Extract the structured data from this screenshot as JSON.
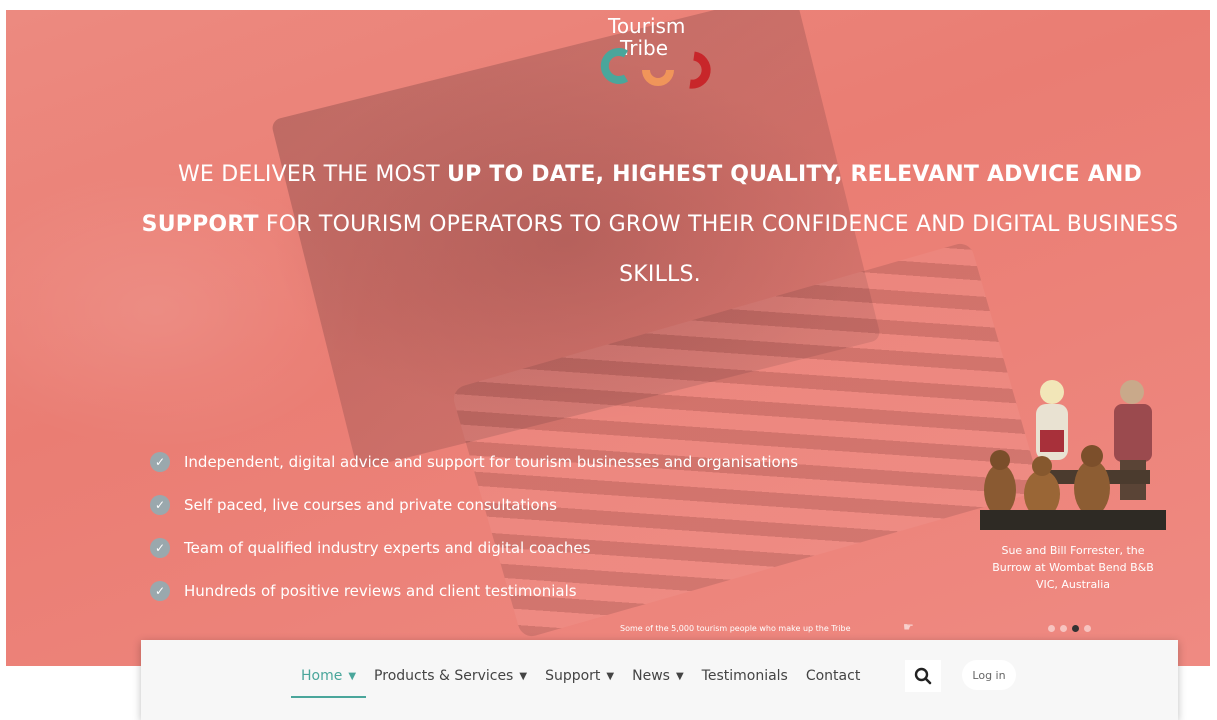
{
  "logo": {
    "line1": "Tourism",
    "line2": "Tribe"
  },
  "headline": {
    "p1": "We deliver the most ",
    "b1": "up to date, highest quality, relevant advice and support",
    "p2": " for tourism operators to grow their confidence and digital business skills."
  },
  "features": [
    "Independent, digital advice and support for tourism businesses and organisations",
    "Self paced, live courses and private consultations",
    "Team of qualified industry experts and digital coaches",
    "Hundreds of positive reviews and client testimonials"
  ],
  "testimonial": {
    "caption_line1": "Sue and Bill Forrester, the",
    "caption_line2": "Burrow at Wombat Bend B&B",
    "caption_line3": "VIC, Australia"
  },
  "tribe_note": "Some of the 5,000 tourism people who make up the Tribe",
  "nav": {
    "home": "Home",
    "products": "Products & Services",
    "support": "Support",
    "news": "News",
    "testimonials": "Testimonials",
    "contact": "Contact",
    "login": "Log in"
  },
  "icons": {
    "check": "check-icon",
    "search": "search-icon",
    "chevron": "chevron-down-icon",
    "hand": "hand-pointer-icon"
  },
  "colors": {
    "accent": "#4aa69b",
    "hero": "#ea7d73"
  }
}
